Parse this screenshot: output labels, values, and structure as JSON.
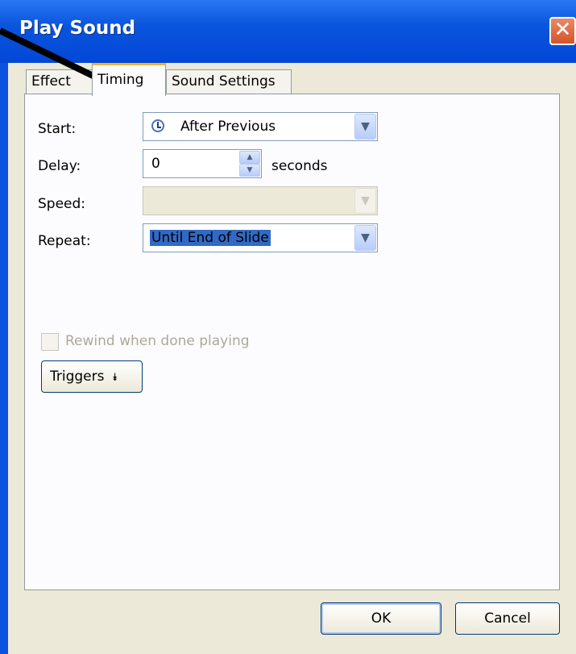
{
  "window": {
    "title": "Play Sound",
    "close_glyph": "✕"
  },
  "tabs": [
    {
      "label": "Effect"
    },
    {
      "label": "Timing"
    },
    {
      "label": "Sound Settings"
    }
  ],
  "timing": {
    "start_label": "Start:",
    "start_value": "After Previous",
    "delay_label": "Delay:",
    "delay_value": "0",
    "delay_unit": "seconds",
    "speed_label": "Speed:",
    "speed_value": "",
    "repeat_label": "Repeat:",
    "repeat_value": "Until End of Slide",
    "rewind_label": "Rewind when done playing",
    "rewind_checked": false,
    "triggers_label": "Triggers"
  },
  "footer": {
    "ok_label": "OK",
    "cancel_label": "Cancel"
  },
  "icons": {
    "clock": "clock-icon",
    "dropdown": "chevron-down-icon",
    "triggers": "double-chevron-down-icon"
  },
  "colors": {
    "titlebar": "#0a55dd",
    "selection": "#316ac5",
    "tab_highlight": "#f7b232"
  }
}
